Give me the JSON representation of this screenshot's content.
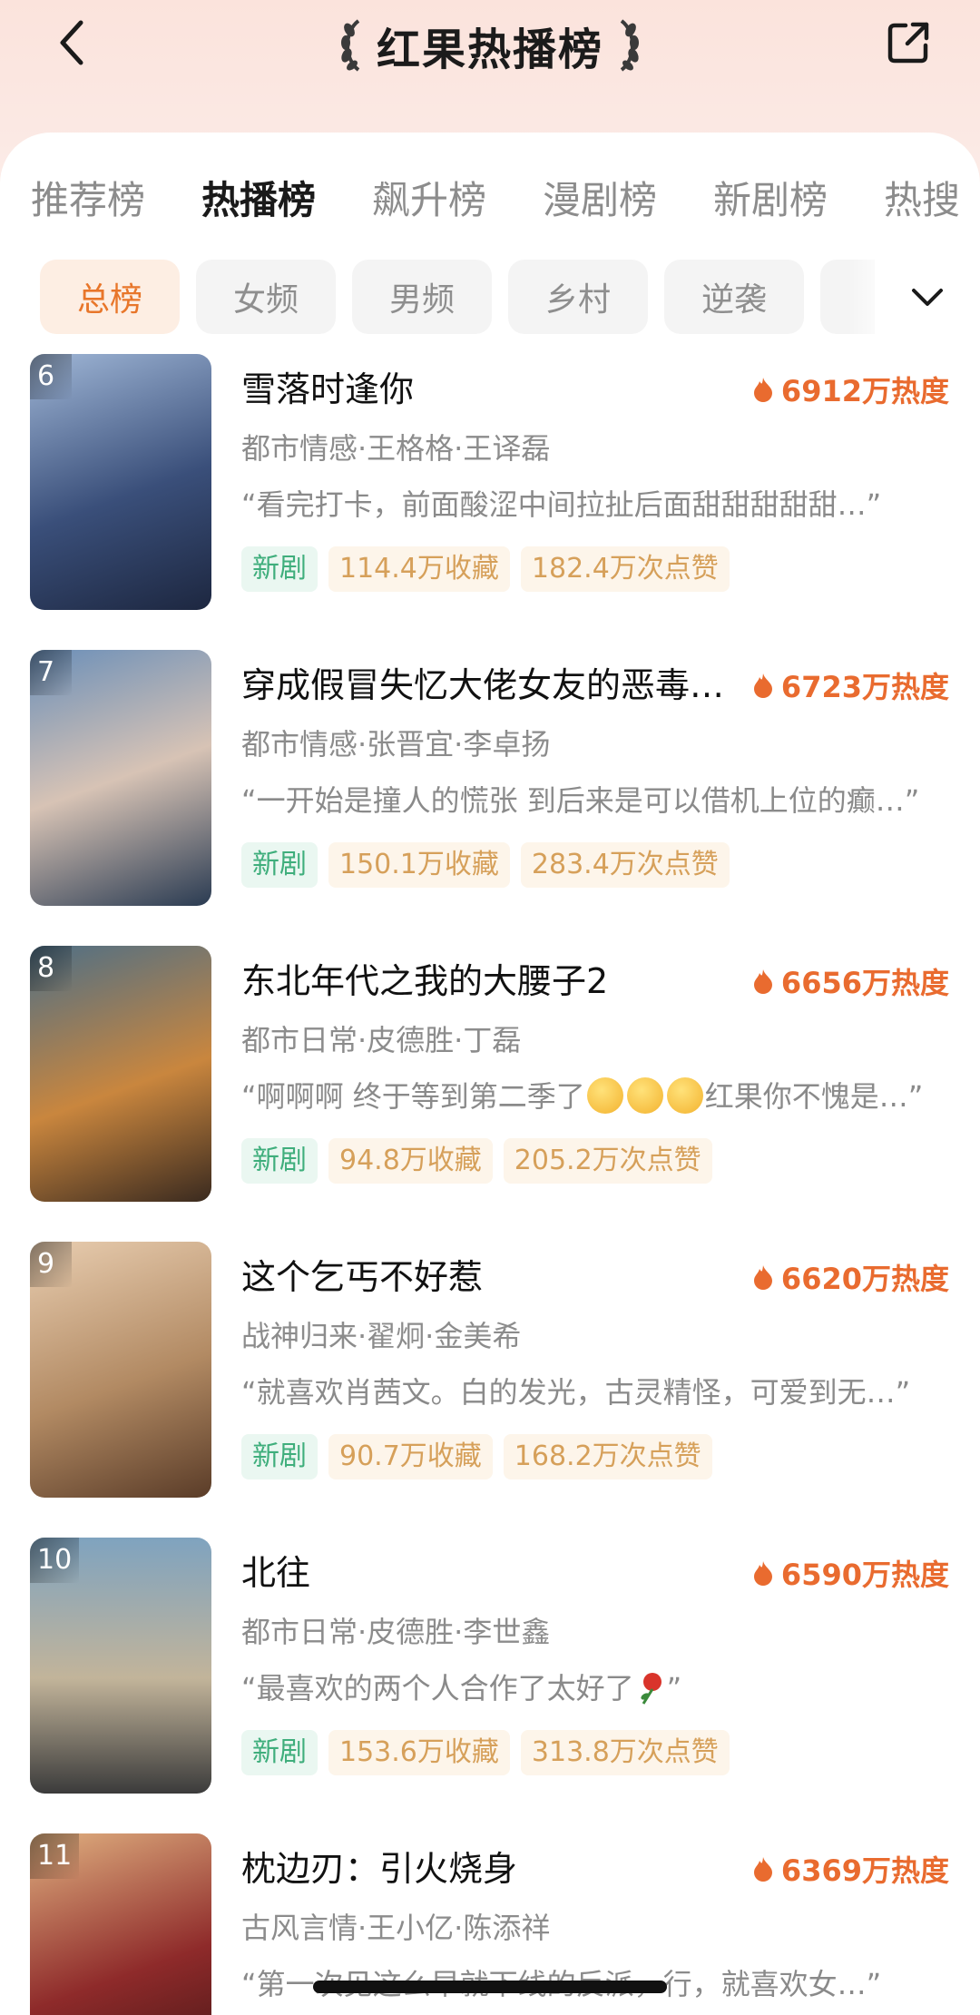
{
  "header": {
    "title": "红果热播榜"
  },
  "tabs": [
    "推荐榜",
    "热播榜",
    "飙升榜",
    "漫剧榜",
    "新剧榜",
    "热搜"
  ],
  "active_tab": "热播榜",
  "chips": [
    "总榜",
    "女频",
    "男频",
    "乡村",
    "逆袭"
  ],
  "active_chip": "总榜",
  "items": [
    {
      "rank": "6",
      "title": "雪落时逢你",
      "heat": "6912万热度",
      "meta": "都市情感·王格格·王译磊",
      "quote": "“看完打卡，前面酸涩中间拉扯后面甜甜甜甜甜…”",
      "tag_new": "新剧",
      "favorites": "114.4万收藏",
      "likes": "182.4万次点赞",
      "poster_colors": [
        "#3a4f7a",
        "#9fb6d6",
        "#1d2740"
      ]
    },
    {
      "rank": "7",
      "title": "穿成假冒失忆大佬女友的恶毒…",
      "heat": "6723万热度",
      "meta": "都市情感·张晋宜·李卓扬",
      "quote": "“一开始是撞人的慌张 到后来是可以借机上位的癫…”",
      "tag_new": "新剧",
      "favorites": "150.1万收藏",
      "likes": "283.4万次点赞",
      "poster_colors": [
        "#6b8fb8",
        "#d7c3b5",
        "#2a3b52"
      ]
    },
    {
      "rank": "8",
      "title": "东北年代之我的大腰子2",
      "heat": "6656万热度",
      "meta": "都市日常·皮德胜·丁磊",
      "quote_before": "“啊啊啊 终于等到第二季了",
      "quote_after": "红果你不愧是…”",
      "tag_new": "新剧",
      "favorites": "94.8万收藏",
      "likes": "205.2万次点赞",
      "poster_colors": [
        "#4e6f86",
        "#c9863e",
        "#3a2a1f"
      ]
    },
    {
      "rank": "9",
      "title": "这个乞丐不好惹",
      "heat": "6620万热度",
      "meta": "战神归来·翟炯·金美希",
      "quote": "“就喜欢肖茜文。白的发光，古灵精怪，可爱到无…”",
      "tag_new": "新剧",
      "favorites": "90.7万收藏",
      "likes": "168.2万次点赞",
      "poster_colors": [
        "#b28a63",
        "#e8cdb0",
        "#5a3c28"
      ]
    },
    {
      "rank": "10",
      "title": "北往",
      "heat": "6590万热度",
      "meta": "都市日常·皮德胜·李世鑫",
      "quote": "“最喜欢的两个人合作了太好了",
      "quote_end": "”",
      "tag_new": "新剧",
      "favorites": "153.6万收藏",
      "likes": "313.8万次点赞",
      "poster_colors": [
        "#7fa3bf",
        "#c2b49a",
        "#3b3b3b"
      ]
    },
    {
      "rank": "11",
      "title": "枕边刃：引火烧身",
      "heat": "6369万热度",
      "meta": "古风言情·王小亿·陈添祥",
      "quote": "“第一次见这么早就下线的反派，行，就喜欢女…”",
      "poster_colors": [
        "#8e2a2a",
        "#e0b080",
        "#3d1414"
      ]
    }
  ],
  "icons": {
    "back": "chevron-left-icon",
    "share": "share-icon",
    "expand": "chevron-down-icon",
    "heat": "flame-icon",
    "laurel": "laurel-icon"
  },
  "colors": {
    "accent": "#e96b2f",
    "new_tag_text": "#3fae7c",
    "stat_tag_text": "#d6a05a"
  }
}
